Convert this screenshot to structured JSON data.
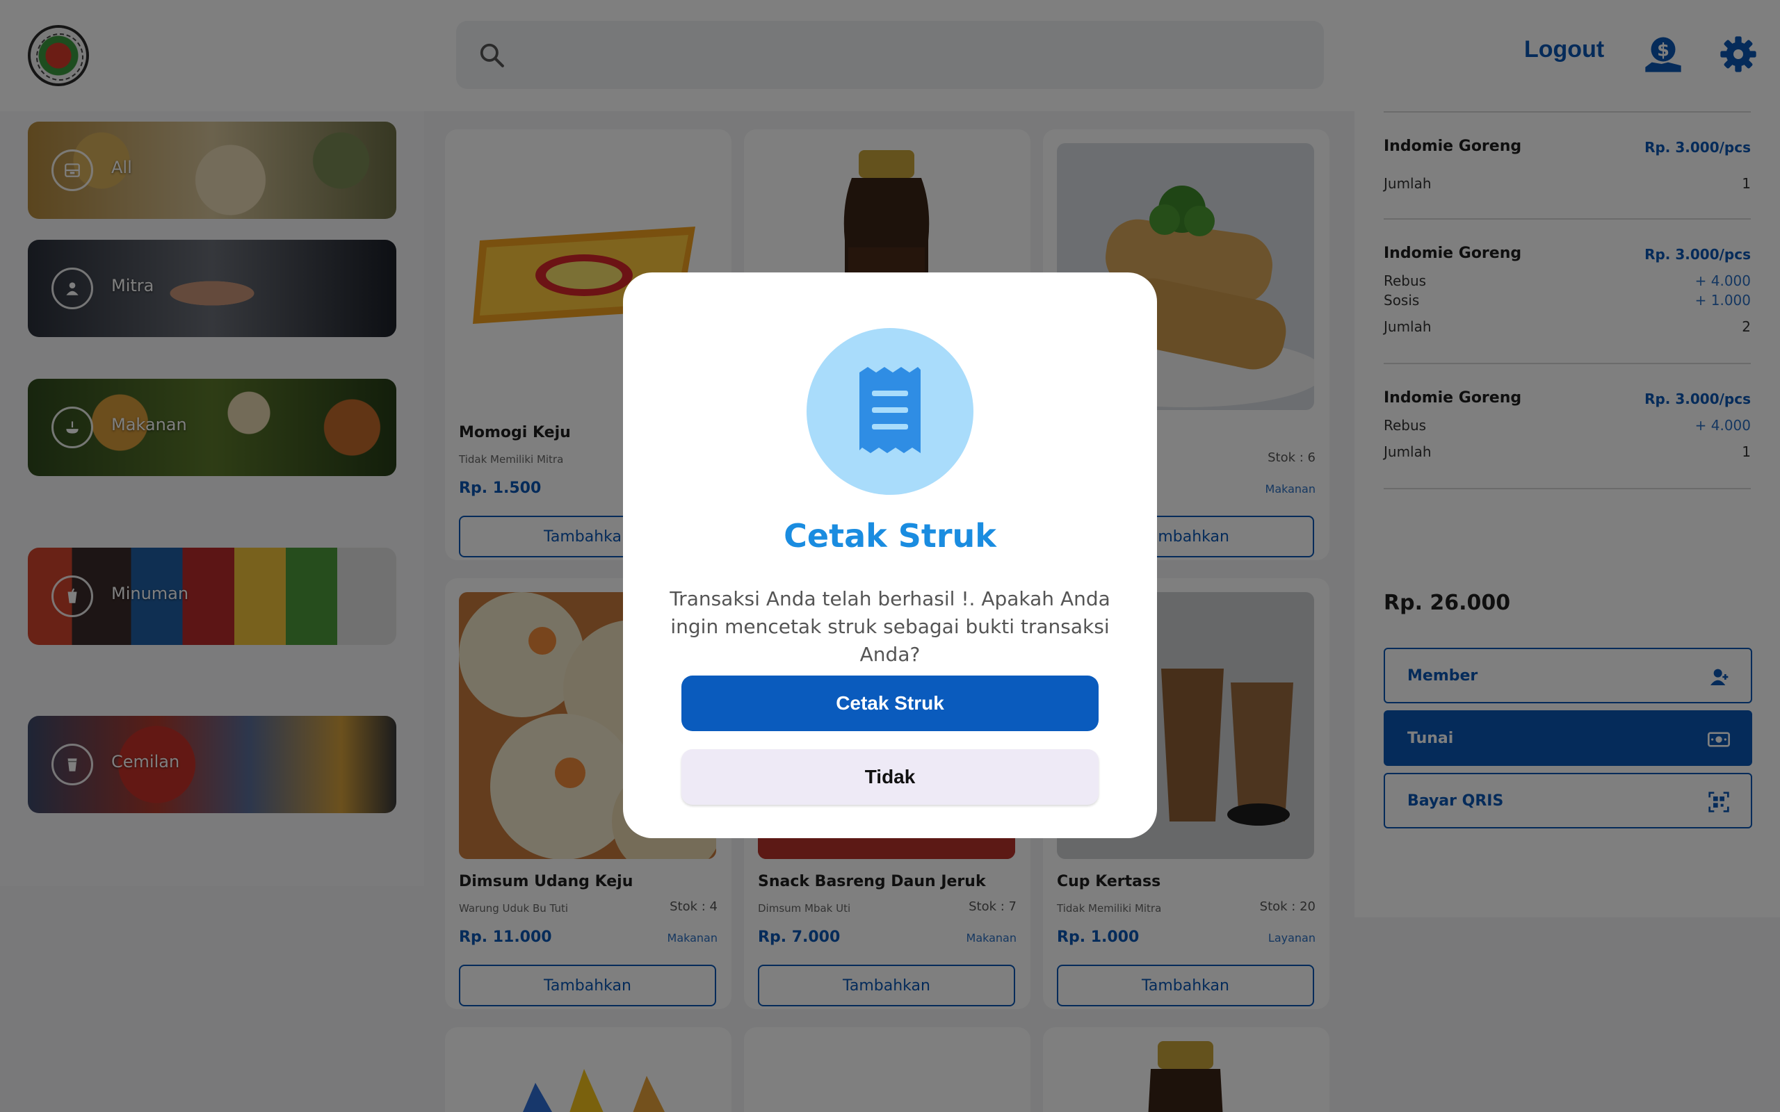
{
  "header": {
    "logout_label": "Logout",
    "search_placeholder": "",
    "icons": [
      "search-icon",
      "money-hand-icon",
      "gear-icon"
    ],
    "accent_color": "#0a56b4"
  },
  "categories": [
    {
      "label": "All",
      "icon": "box-icon"
    },
    {
      "label": "Mitra",
      "icon": "person-icon"
    },
    {
      "label": "Makanan",
      "icon": "food-icon"
    },
    {
      "label": "Minuman",
      "icon": "drink-icon"
    },
    {
      "label": "Cemilan",
      "icon": "snack-icon"
    }
  ],
  "products": [
    {
      "name": "Momogi Keju",
      "mitra": "Tidak Memiliki Mitra",
      "stock": "",
      "price": "Rp. 1.500",
      "category": "",
      "button": "Tambahkan"
    },
    {
      "name": "",
      "mitra": "",
      "stock": "",
      "price": "",
      "category": "",
      "button": ""
    },
    {
      "name": "",
      "mitra": "",
      "stock": "Stok : 6",
      "price": "",
      "category": "Makanan",
      "button": "Tambahkan"
    },
    {
      "name": "Dimsum Udang Keju",
      "mitra": "Warung Uduk Bu Tuti",
      "stock": "Stok : 4",
      "price": "Rp. 11.000",
      "category": "Makanan",
      "button": "Tambahkan"
    },
    {
      "name": "Snack Basreng Daun Jeruk",
      "mitra": "Dimsum Mbak Uti",
      "stock": "Stok : 7",
      "price": "Rp. 7.000",
      "category": "Makanan",
      "button": "Tambahkan"
    },
    {
      "name": "Cup Kertass",
      "mitra": "Tidak Memiliki Mitra",
      "stock": "Stok : 20",
      "price": "Rp. 1.000",
      "category": "Layanan",
      "button": "Tambahkan"
    }
  ],
  "cart": {
    "items": [
      {
        "name": "Indomie Goreng",
        "price": "Rp. 3.000/pcs",
        "addons": [],
        "qty_label": "Jumlah",
        "qty": "1"
      },
      {
        "name": "Indomie Goreng",
        "price": "Rp. 3.000/pcs",
        "addons": [
          {
            "label": "Rebus",
            "price": "+ 4.000"
          },
          {
            "label": "Sosis",
            "price": "+ 1.000"
          }
        ],
        "qty_label": "Jumlah",
        "qty": "2"
      },
      {
        "name": "Indomie Goreng",
        "price": "Rp. 3.000/pcs",
        "addons": [
          {
            "label": "Rebus",
            "price": "+ 4.000"
          }
        ],
        "qty_label": "Jumlah",
        "qty": "1"
      }
    ],
    "total": "Rp. 26.000",
    "payment": [
      {
        "label": "Member",
        "icon": "person-icon",
        "selected": false
      },
      {
        "label": "Tunai",
        "icon": "cash-icon",
        "selected": true
      },
      {
        "label": "Bayar QRIS",
        "icon": "qr-icon",
        "selected": false
      }
    ]
  },
  "modal": {
    "icon": "receipt-icon",
    "title": "Cetak Struk",
    "message": "Transaksi Anda telah berhasil !. Apakah Anda ingin mencetak struk sebagai bukti transaksi Anda?",
    "primary_label": "Cetak Struk",
    "secondary_label": "Tidak",
    "icon_bg": "#a9dcfb",
    "icon_fg": "#2f8de4"
  }
}
